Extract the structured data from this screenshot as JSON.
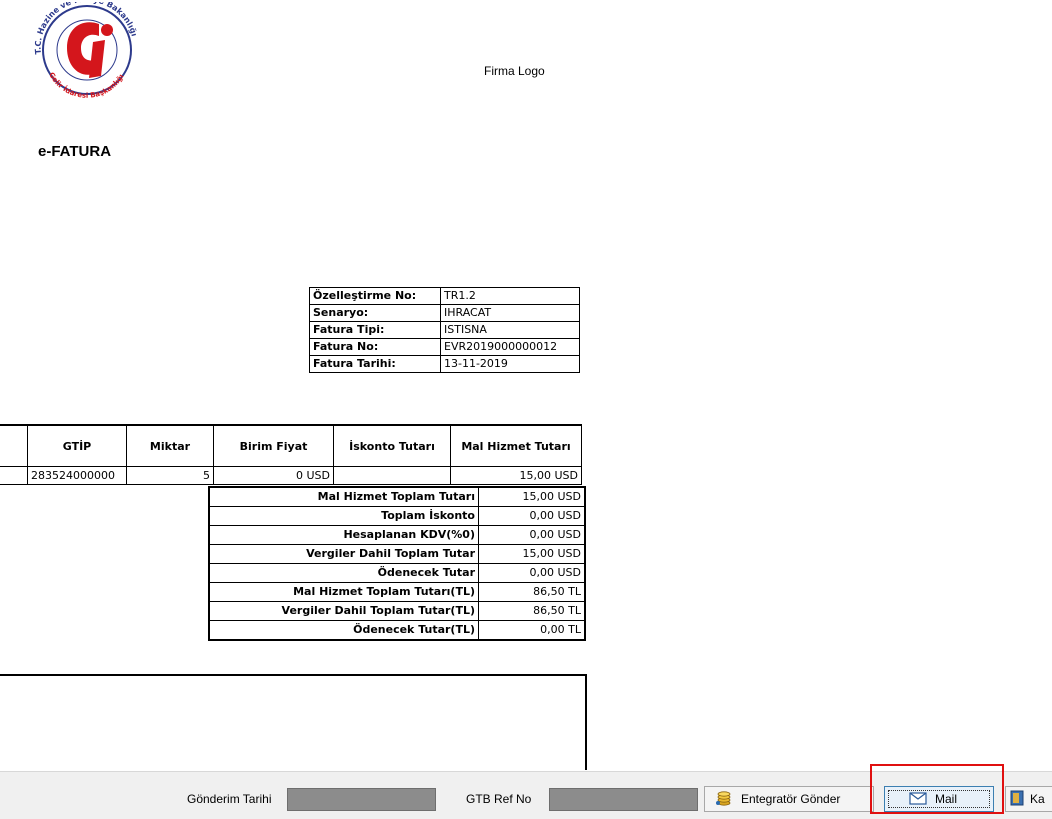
{
  "header": {
    "logo_text_top": "T.C. Hazine ve Maliye Bakanlığı",
    "logo_text_bottom": "Gelir İdaresi Başkanlığı",
    "firma_logo": "Firma Logo",
    "title": "e-FATURA"
  },
  "meta": [
    {
      "key": "Özelleştirme No:",
      "value": "TR1.2"
    },
    {
      "key": "Senaryo:",
      "value": "IHRACAT"
    },
    {
      "key": "Fatura Tipi:",
      "value": "ISTISNA"
    },
    {
      "key": "Fatura No:",
      "value": "EVR2019000000012"
    },
    {
      "key": "Fatura Tarihi:",
      "value": "13-11-2019"
    }
  ],
  "items": {
    "headers": [
      "GTİP",
      "Miktar",
      "Birim Fiyat",
      "İskonto Tutarı",
      "Mal Hizmet Tutarı"
    ],
    "rows": [
      {
        "gtip": "283524000000",
        "miktar": "5",
        "birim_fiyat": "0 USD",
        "iskonto": "",
        "tutar": "15,00 USD"
      }
    ]
  },
  "totals": [
    {
      "key": "Mal Hizmet Toplam Tutarı",
      "value": "15,00 USD"
    },
    {
      "key": "Toplam İskonto",
      "value": "0,00 USD"
    },
    {
      "key": "Hesaplanan KDV(%0)",
      "value": "0,00 USD"
    },
    {
      "key": "Vergiler Dahil Toplam Tutar",
      "value": "15,00 USD"
    },
    {
      "key": "Ödenecek Tutar",
      "value": "0,00 USD"
    },
    {
      "key": "Mal Hizmet Toplam Tutarı(TL)",
      "value": "86,50 TL"
    },
    {
      "key": "Vergiler Dahil Toplam Tutar(TL)",
      "value": "86,50 TL"
    },
    {
      "key": "Ödenecek Tutar(TL)",
      "value": "0,00 TL"
    }
  ],
  "toolbar": {
    "gonderim_label": "Gönderim Tarihi",
    "gtb_label": "GTB Ref No",
    "entegrator_button": "Entegratör Gönder",
    "mail_button": "Mail",
    "kapat_button": "Ka"
  },
  "colors": {
    "logo_red": "#d4161c",
    "logo_blue": "#2d3a8c",
    "highlight": "#e01010",
    "field_gray": "#8c8c8c"
  }
}
